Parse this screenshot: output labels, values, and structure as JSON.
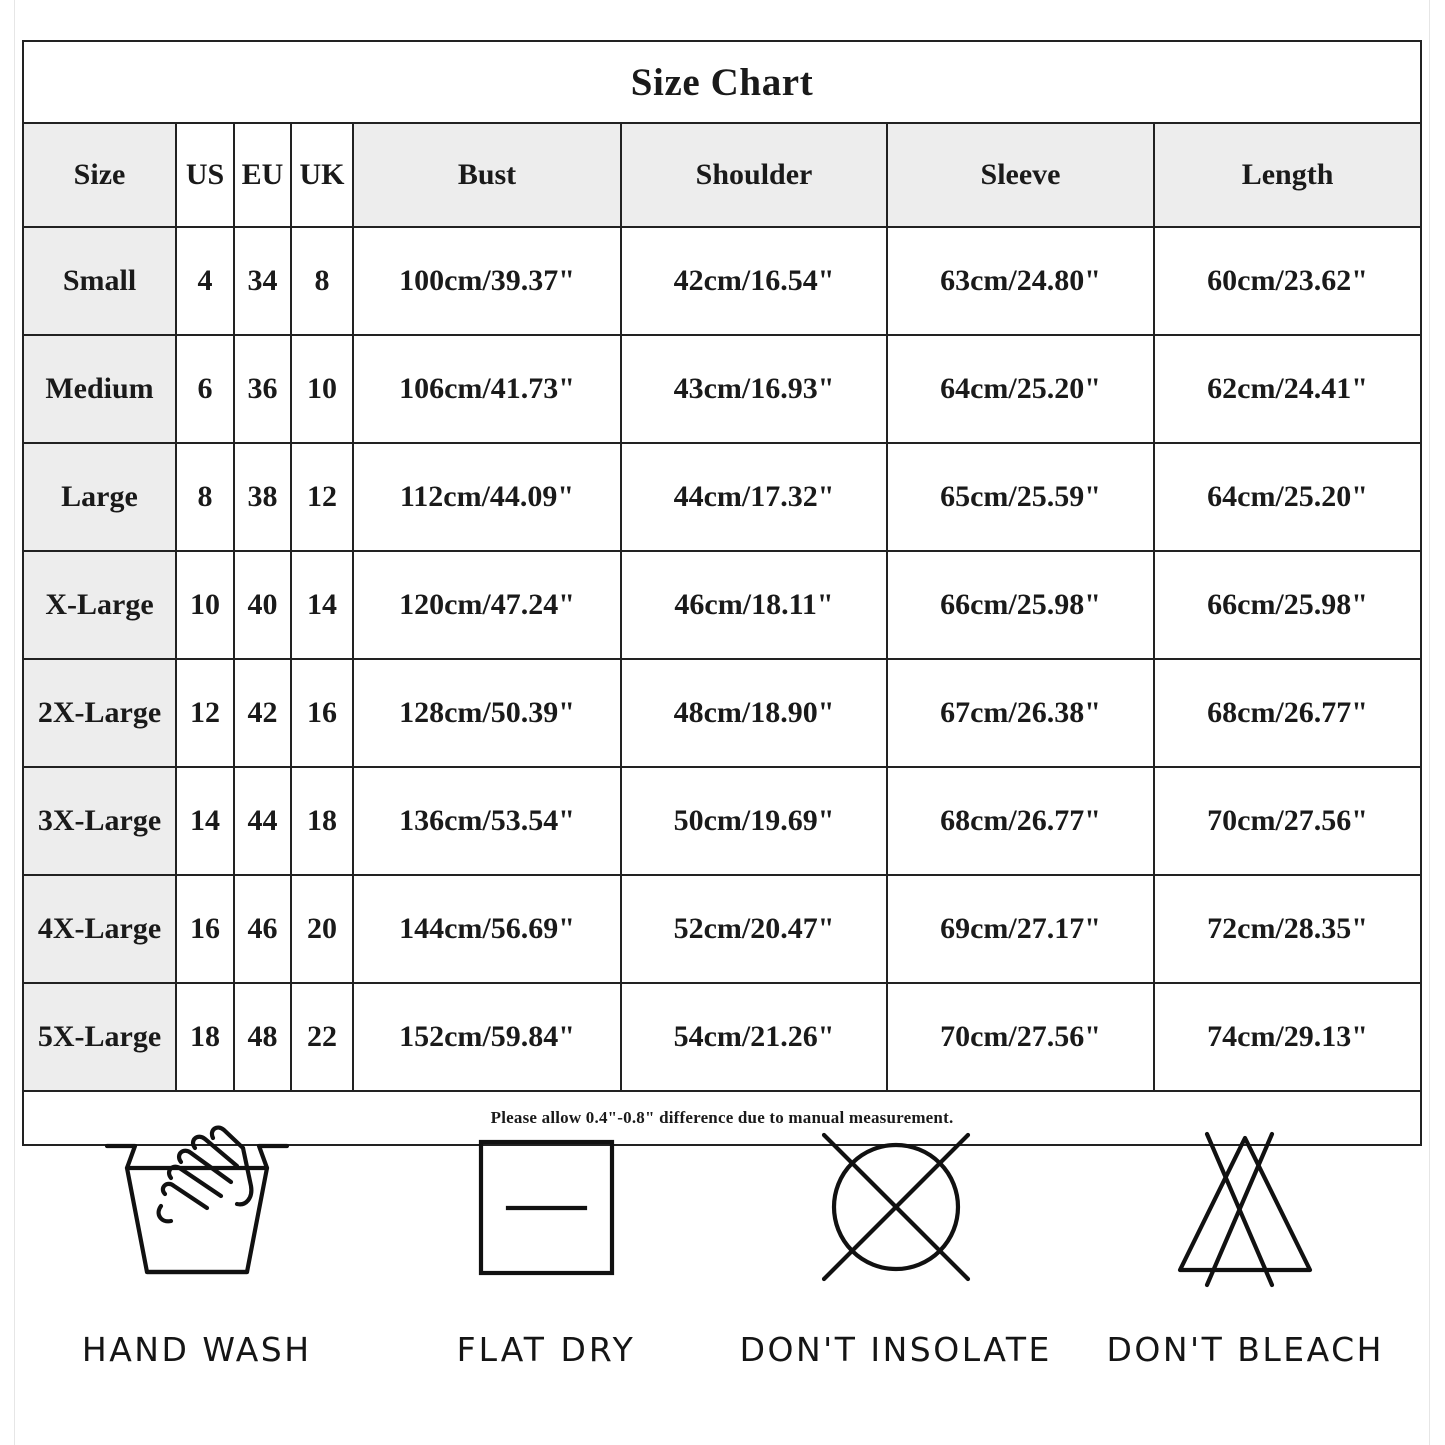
{
  "chart": {
    "title": "Size Chart",
    "columns": [
      "Size",
      "US",
      "EU",
      "UK",
      "Bust",
      "Shoulder",
      "Sleeve",
      "Length"
    ],
    "rows": [
      {
        "size": "Small",
        "us": "4",
        "eu": "34",
        "uk": "8",
        "bust": "100cm/39.37\"",
        "shoulder": "42cm/16.54\"",
        "sleeve": "63cm/24.80\"",
        "length": "60cm/23.62\""
      },
      {
        "size": "Medium",
        "us": "6",
        "eu": "36",
        "uk": "10",
        "bust": "106cm/41.73\"",
        "shoulder": "43cm/16.93\"",
        "sleeve": "64cm/25.20\"",
        "length": "62cm/24.41\""
      },
      {
        "size": "Large",
        "us": "8",
        "eu": "38",
        "uk": "12",
        "bust": "112cm/44.09\"",
        "shoulder": "44cm/17.32\"",
        "sleeve": "65cm/25.59\"",
        "length": "64cm/25.20\""
      },
      {
        "size": "X-Large",
        "us": "10",
        "eu": "40",
        "uk": "14",
        "bust": "120cm/47.24\"",
        "shoulder": "46cm/18.11\"",
        "sleeve": "66cm/25.98\"",
        "length": "66cm/25.98\""
      },
      {
        "size": "2X-Large",
        "us": "12",
        "eu": "42",
        "uk": "16",
        "bust": "128cm/50.39\"",
        "shoulder": "48cm/18.90\"",
        "sleeve": "67cm/26.38\"",
        "length": "68cm/26.77\""
      },
      {
        "size": "3X-Large",
        "us": "14",
        "eu": "44",
        "uk": "18",
        "bust": "136cm/53.54\"",
        "shoulder": "50cm/19.69\"",
        "sleeve": "68cm/26.77\"",
        "length": "70cm/27.56\""
      },
      {
        "size": "4X-Large",
        "us": "16",
        "eu": "46",
        "uk": "20",
        "bust": "144cm/56.69\"",
        "shoulder": "52cm/20.47\"",
        "sleeve": "69cm/27.17\"",
        "length": "72cm/28.35\""
      },
      {
        "size": "5X-Large",
        "us": "18",
        "eu": "48",
        "uk": "22",
        "bust": "152cm/59.84\"",
        "shoulder": "54cm/21.26\"",
        "sleeve": "70cm/27.56\"",
        "length": "74cm/29.13\""
      }
    ],
    "note": "Please allow 0.4\"-0.8\" difference due to manual measurement."
  },
  "care_symbols": [
    {
      "icon": "hand-wash-icon",
      "label": "HAND WASH"
    },
    {
      "icon": "flat-dry-icon",
      "label": "FLAT  DRY"
    },
    {
      "icon": "no-insolate-icon",
      "label": "DON'T INSOLATE"
    },
    {
      "icon": "no-bleach-icon",
      "label": "DON'T BLEACH"
    }
  ],
  "colors": {
    "border": "#222222",
    "header_fill": "#ededed",
    "title_fill": "#f0f0f0",
    "note_fill": "#f0f0f0",
    "cell_fill": "#ffffff",
    "text": "#1a1a1a"
  }
}
